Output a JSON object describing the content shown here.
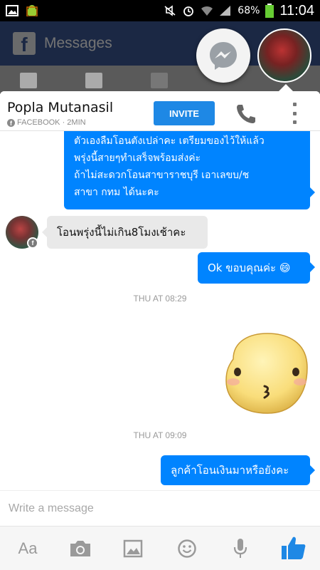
{
  "status_bar": {
    "battery": "68%",
    "time": "11:04"
  },
  "background_app": {
    "title": "Messages"
  },
  "chat": {
    "contact_name": "Popla Mutanasil",
    "contact_sub": "FACEBOOK · 2MIN",
    "invite_label": "INVITE"
  },
  "messages": {
    "m1_line1": "ตัวเองลืมโอนตังเปล่าคะ เตรียมของไว้ให้แล้ว",
    "m1_line2": "พรุ่งนี้สายๆทำเสร็จพร้อมส่งค่ะ",
    "m1_line3": " ถ้าไม่สะดวกโอนสาขาราชบุรี เอาเลขบ/ช",
    "m1_line4": "สาขา กทม ได้นะคะ",
    "m2": "โอนพรุ่งนี้ไม่เกิน8โมงเช้าคะ",
    "m3": "Ok ขอบคุณค่ะ 😄",
    "ts1": "THU AT 08:29",
    "ts2": "THU AT 09:09",
    "m4": "ลูกค้าโอนเงินมาหรือยังคะ"
  },
  "composer": {
    "placeholder": "Write a message"
  },
  "toolbar": {
    "aa_label": "Aa"
  },
  "colors": {
    "accent": "#0084ff",
    "invite": "#1e88e5",
    "facebook": "#3b5998"
  }
}
